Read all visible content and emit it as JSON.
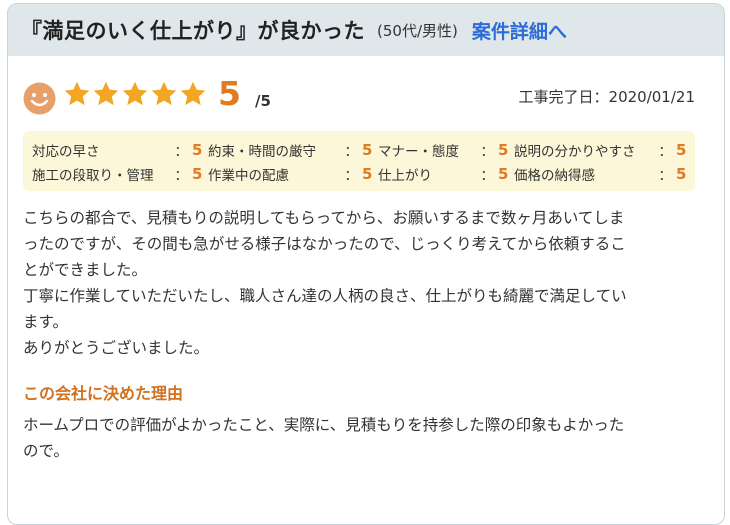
{
  "header": {
    "title": "『満足のいく仕上がり』が良かった",
    "meta": "(50代/男性)",
    "detail_link": "案件詳細へ"
  },
  "rating": {
    "stars": 5,
    "score": "5",
    "max": "/5",
    "icon": "smiley-face-icon"
  },
  "completion": {
    "label": "工事完了日：",
    "date": "2020/01/21"
  },
  "criteria": [
    {
      "label": "対応の早さ",
      "value": "5"
    },
    {
      "label": "約束・時間の厳守",
      "value": "5"
    },
    {
      "label": "マナー・態度",
      "value": "5"
    },
    {
      "label": "説明の分かりやすさ",
      "value": "5"
    },
    {
      "label": "施工の段取り・管理",
      "value": "5"
    },
    {
      "label": "作業中の配慮",
      "value": "5"
    },
    {
      "label": "仕上がり",
      "value": "5"
    },
    {
      "label": "価格の納得感",
      "value": "5"
    }
  ],
  "review": {
    "lines": [
      "こちらの都合で、見積もりの説明してもらってから、お願いするまで数ヶ月あいてしま",
      "ったのですが、その間も急がせる様子はなかったので、じっくり考えてから依頼するこ",
      "とができました。",
      "丁寧に作業していただいたし、職人さん達の人柄の良さ、仕上がりも綺麗で満足してい",
      "ます。",
      "ありがとうございました。"
    ]
  },
  "reason": {
    "title": "この会社に決めた理由",
    "lines": [
      "ホームプロでの評価がよかったこと、実際に、見積もりを持参した際の印象もよかった",
      "ので。"
    ]
  },
  "colors": {
    "header_bg": "#dfe7ea",
    "link": "#2b6cd6",
    "accent_orange": "#e07b20",
    "star": "#f2a623",
    "criteria_bg": "#fcf7d8"
  }
}
